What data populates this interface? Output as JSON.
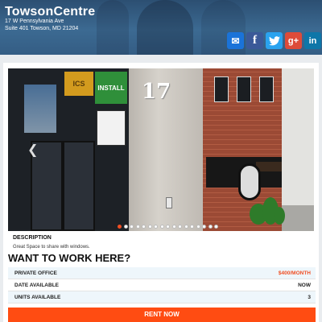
{
  "header": {
    "title": "TowsonCentre",
    "address_line1": "17 W Pennsylvania Ave",
    "address_line2": "Suite 401 Towson, MD 21204"
  },
  "social": [
    {
      "name": "email-icon",
      "glyph": "✉",
      "color": "#1a73d9"
    },
    {
      "name": "facebook-icon",
      "glyph": "f",
      "color": "#3b5998"
    },
    {
      "name": "twitter-icon",
      "glyph": "t",
      "color": "#2aa3ef"
    },
    {
      "name": "google-plus-icon",
      "glyph": "g+",
      "color": "#dd4b39"
    },
    {
      "name": "linkedin-icon",
      "glyph": "in",
      "color": "#0e76a8"
    }
  ],
  "gallery": {
    "building_number": "17",
    "sign_green": "INSTALL",
    "sign_yellow": "ICS",
    "slide_count": 17,
    "active_slide": 1
  },
  "listing": {
    "description_label": "DESCRIPTION",
    "description_text": "Great Space to share with windows.",
    "headline": "WANT TO WORK HERE?",
    "rows": [
      {
        "label": "PRIVATE OFFICE",
        "value": "$400/MONTH"
      },
      {
        "label": "DATE AVAILABLE",
        "value": "NOW"
      },
      {
        "label": "UNITS AVAILABLE",
        "value": "3"
      }
    ],
    "cta": "RENT NOW"
  },
  "colors": {
    "accent": "#ff4c12",
    "price": "#f04e23",
    "header": "#2c4f72"
  }
}
